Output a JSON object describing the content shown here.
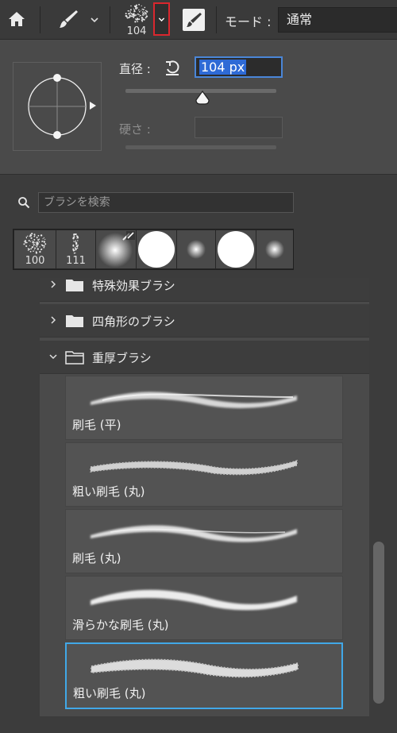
{
  "toolbar": {
    "preset_size": "104",
    "mode_label": "モード :",
    "mode_value": "通常",
    "icons": [
      "home-icon",
      "brush-tool-icon",
      "chevron-down-icon",
      "brush-preset-icon",
      "brush-settings-panel-icon"
    ]
  },
  "settings": {
    "diameter_label": "直径 :",
    "diameter_value": "104 px",
    "diameter_slider_fraction": 0.48,
    "hardness_label": "硬さ :",
    "hardness_value": ""
  },
  "search": {
    "placeholder": "ブラシを検索"
  },
  "recent": [
    {
      "size": "100",
      "kind": "spatter"
    },
    {
      "size": "111",
      "kind": "spatter-thin"
    },
    {
      "size": "",
      "kind": "soft-round-large"
    },
    {
      "size": "",
      "kind": "hard-round"
    },
    {
      "size": "",
      "kind": "soft-round-small"
    },
    {
      "size": "",
      "kind": "hard-round"
    },
    {
      "size": "",
      "kind": "soft-round-small"
    }
  ],
  "groups": [
    {
      "label": "特殊効果ブラシ",
      "expanded": false
    },
    {
      "label": "四角形のブラシ",
      "expanded": false
    },
    {
      "label": "重厚ブラシ",
      "expanded": true
    }
  ],
  "brushes": [
    {
      "name": "刷毛 (平)",
      "selected": false
    },
    {
      "name": "粗い刷毛 (丸)",
      "selected": false
    },
    {
      "name": "刷毛 (丸)",
      "selected": false
    },
    {
      "name": "滑らかな刷毛 (丸)",
      "selected": false
    },
    {
      "name": "粗い刷毛 (丸)",
      "selected": true
    }
  ],
  "colors": {
    "accent_selected": "#41a8e8",
    "highlight_toggle": "#d9272e",
    "input_focus": "#4a86d8"
  }
}
